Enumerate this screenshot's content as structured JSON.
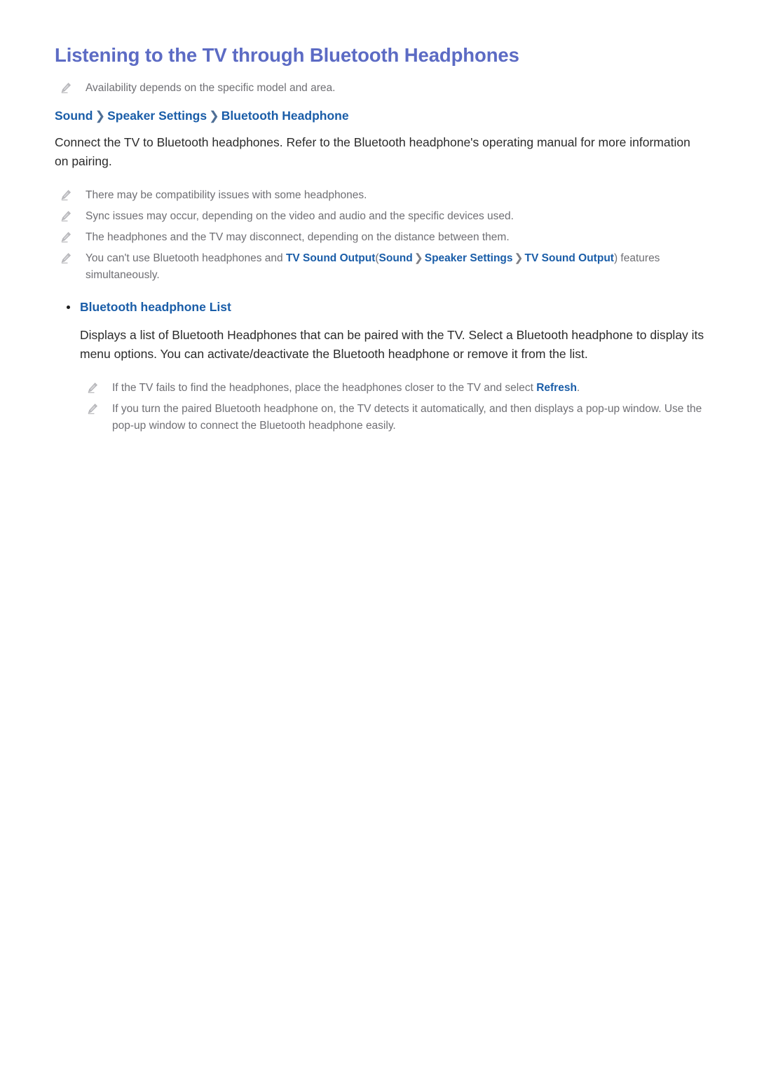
{
  "page": {
    "title": "Listening to the TV through Bluetooth Headphones",
    "background_color": "#ffffff"
  },
  "colors": {
    "title": "#5c6bc4",
    "link": "#1a5da8",
    "note_text": "#6f6f74",
    "body_text": "#2b2b2b",
    "bullet": "#1d1d1d"
  },
  "icons": {
    "note": "pencil-note-icon",
    "bullet": "bullet-dot-icon"
  },
  "notes": {
    "availability": "Availability depends on the specific model and area.",
    "compatibility": "There may be compatibility issues with some headphones.",
    "sync": "Sync issues may occur, depending on the video and audio and the specific devices used.",
    "disconnect": "The headphones and the TV may disconnect, depending on the distance between them."
  },
  "breadcrumb": {
    "items": [
      "Sound",
      "Speaker Settings",
      "Bluetooth Headphone"
    ],
    "separator": "❯",
    "item1": "Sound",
    "item2": "Speaker Settings",
    "item3": "Bluetooth Headphone"
  },
  "intro": {
    "paragraph": "Connect the TV to Bluetooth headphones. Refer to the Bluetooth headphone's operating manual for more information on pairing."
  },
  "conflict_note": {
    "prefix": "You can't use Bluetooth headphones and ",
    "link1": "TV Sound Output",
    "paren_open": "(",
    "path1": "Sound",
    "path_sep": "❯",
    "path2": "Speaker Settings",
    "path3": "TV Sound Output",
    "paren_close": ")",
    "suffix": " features simultaneously."
  },
  "section": {
    "heading": "Bluetooth headphone List",
    "description": "Displays a list of Bluetooth Headphones that can be paired with the TV. Select a Bluetooth headphone to display its menu options. You can activate/deactivate the Bluetooth headphone or remove it from the list."
  },
  "section_notes": {
    "refresh_prefix": "If the TV fails to find the headphones, place the headphones closer to the TV and select ",
    "refresh_link": "Refresh",
    "refresh_suffix": ".",
    "popup": "If you turn the paired Bluetooth headphone on, the TV detects it automatically, and then displays a pop-up window. Use the pop-up window to connect the Bluetooth headphone easily."
  }
}
